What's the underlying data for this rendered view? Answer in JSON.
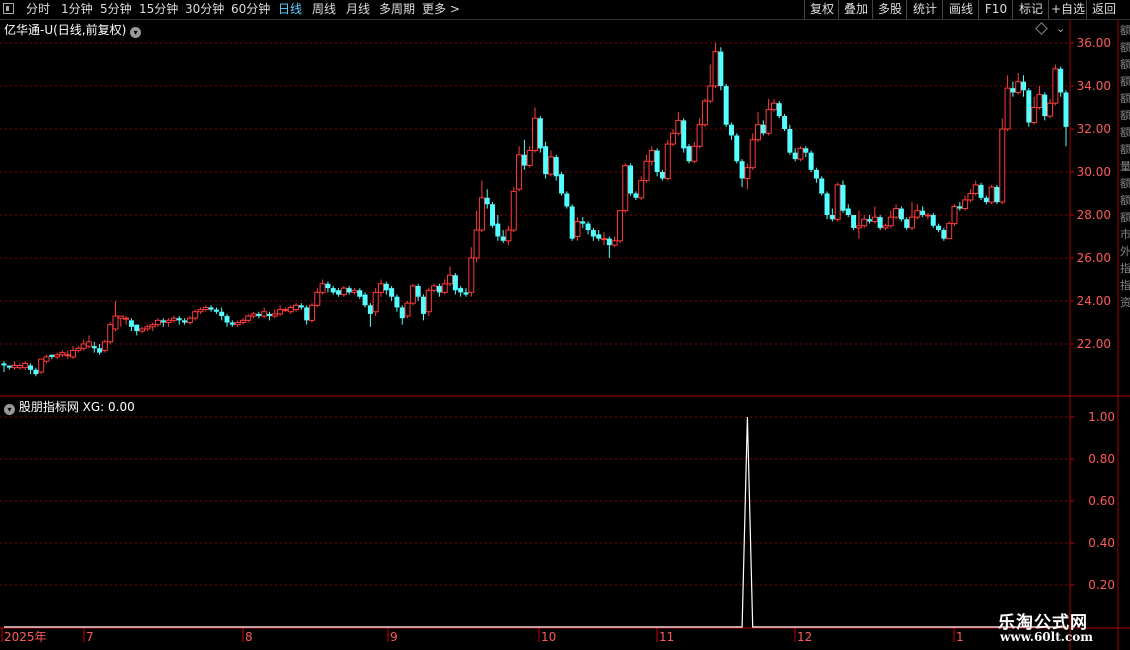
{
  "toolbar": {
    "periods": [
      "分时",
      "1分钟",
      "5分钟",
      "15分钟",
      "30分钟",
      "60分钟",
      "日线",
      "周线",
      "月线",
      "多周期",
      "更多 >"
    ],
    "active_period": "日线",
    "buttons": [
      "复权",
      "叠加",
      "多股",
      "统计",
      "画线",
      "F10",
      "标记",
      "+自选",
      "返回"
    ]
  },
  "main_chart": {
    "title": "亿华通-U(日线,前复权)",
    "price_axis": [
      "36.00",
      "34.00",
      "32.00",
      "30.00",
      "28.00",
      "26.00",
      "24.00",
      "22.00"
    ],
    "candles": [
      [
        21.1,
        21.0,
        20.8,
        20.7,
        21.2
      ],
      [
        21.0,
        20.9,
        20.8,
        20.8,
        21.0
      ],
      [
        20.9,
        21.0,
        20.8,
        20.8,
        21.2
      ],
      [
        20.9,
        21.0,
        20.9,
        20.8,
        21.1
      ],
      [
        20.9,
        21.1,
        20.9,
        20.8,
        21.2
      ],
      [
        21.0,
        20.8,
        20.7,
        20.6,
        21.1
      ],
      [
        20.8,
        20.6,
        20.6,
        20.5,
        20.9
      ],
      [
        20.7,
        21.3,
        20.7,
        20.6,
        21.3
      ],
      [
        21.2,
        21.4,
        21.2,
        21.1,
        21.5
      ],
      [
        21.5,
        21.4,
        21.3,
        21.3,
        21.5
      ],
      [
        21.4,
        21.5,
        21.3,
        21.3,
        21.6
      ],
      [
        21.5,
        21.6,
        21.5,
        21.4,
        21.7
      ],
      [
        21.5,
        21.5,
        21.3,
        21.3,
        21.7
      ],
      [
        21.4,
        21.7,
        21.4,
        21.3,
        21.9
      ],
      [
        21.7,
        21.8,
        21.6,
        21.6,
        21.9
      ],
      [
        21.8,
        22.0,
        21.7,
        21.7,
        22.2
      ],
      [
        21.9,
        22.1,
        21.9,
        21.8,
        22.4
      ],
      [
        21.9,
        21.8,
        21.6,
        21.6,
        22.1
      ],
      [
        21.8,
        21.6,
        21.6,
        21.5,
        22.0
      ],
      [
        21.7,
        22.1,
        21.7,
        21.6,
        22.2
      ],
      [
        22.1,
        22.9,
        22.1,
        22.0,
        23.0
      ],
      [
        22.7,
        23.3,
        22.7,
        22.6,
        24.0
      ],
      [
        23.2,
        23.3,
        23.1,
        22.8,
        23.3
      ],
      [
        23.2,
        23.2,
        23.0,
        22.9,
        23.3
      ],
      [
        23.1,
        22.8,
        22.8,
        22.6,
        23.2
      ],
      [
        22.9,
        22.6,
        22.5,
        22.4,
        22.9
      ],
      [
        22.6,
        22.7,
        22.6,
        22.5,
        22.8
      ],
      [
        22.7,
        22.8,
        22.7,
        22.6,
        22.9
      ],
      [
        22.8,
        22.9,
        22.7,
        22.6,
        23.0
      ],
      [
        22.9,
        23.1,
        22.8,
        22.8,
        23.2
      ],
      [
        23.1,
        23.0,
        22.9,
        22.8,
        23.2
      ],
      [
        23.0,
        23.1,
        22.9,
        22.8,
        23.2
      ],
      [
        23.1,
        23.2,
        23.0,
        23.0,
        23.3
      ],
      [
        23.2,
        23.1,
        23.0,
        22.9,
        23.3
      ],
      [
        23.1,
        23.0,
        22.9,
        22.9,
        23.2
      ],
      [
        23.0,
        23.2,
        23.0,
        22.9,
        23.3
      ],
      [
        23.2,
        23.5,
        23.2,
        23.1,
        23.6
      ],
      [
        23.5,
        23.6,
        23.4,
        23.4,
        23.7
      ],
      [
        23.6,
        23.7,
        23.5,
        23.5,
        23.8
      ],
      [
        23.7,
        23.6,
        23.5,
        23.5,
        23.8
      ],
      [
        23.6,
        23.5,
        23.4,
        23.4,
        23.7
      ],
      [
        23.5,
        23.3,
        23.2,
        23.1,
        23.7
      ],
      [
        23.3,
        23.0,
        22.9,
        22.8,
        23.4
      ],
      [
        23.0,
        22.9,
        22.9,
        22.8,
        23.1
      ],
      [
        22.9,
        23.0,
        22.9,
        22.8,
        23.1
      ],
      [
        23.0,
        23.1,
        22.9,
        22.9,
        23.2
      ],
      [
        23.1,
        23.3,
        23.1,
        23.0,
        23.4
      ],
      [
        23.3,
        23.4,
        23.2,
        23.2,
        23.5
      ],
      [
        23.4,
        23.3,
        23.2,
        23.2,
        23.5
      ],
      [
        23.3,
        23.5,
        23.3,
        23.2,
        23.7
      ],
      [
        23.4,
        23.3,
        23.2,
        23.1,
        23.5
      ],
      [
        23.3,
        23.4,
        23.2,
        23.2,
        23.6
      ],
      [
        23.4,
        23.6,
        23.4,
        23.3,
        23.8
      ],
      [
        23.6,
        23.6,
        23.5,
        23.5,
        23.7
      ],
      [
        23.5,
        23.7,
        23.5,
        23.4,
        23.8
      ],
      [
        23.6,
        23.8,
        23.6,
        23.5,
        23.9
      ],
      [
        23.8,
        23.7,
        23.6,
        23.6,
        23.9
      ],
      [
        23.7,
        23.1,
        23.0,
        22.9,
        23.8
      ],
      [
        23.1,
        23.8,
        23.1,
        23.0,
        23.9
      ],
      [
        23.8,
        24.4,
        23.7,
        23.7,
        24.6
      ],
      [
        24.4,
        24.8,
        24.4,
        24.3,
        25.0
      ],
      [
        24.8,
        24.6,
        24.5,
        24.4,
        24.9
      ],
      [
        24.6,
        24.4,
        24.3,
        24.3,
        24.7
      ],
      [
        24.5,
        24.3,
        24.2,
        24.2,
        24.6
      ],
      [
        24.3,
        24.6,
        24.3,
        24.2,
        24.7
      ],
      [
        24.6,
        24.4,
        24.3,
        24.3,
        24.7
      ],
      [
        24.4,
        24.5,
        24.4,
        24.3,
        24.6
      ],
      [
        24.5,
        24.2,
        24.1,
        24.1,
        24.6
      ],
      [
        24.3,
        23.8,
        23.8,
        23.7,
        24.4
      ],
      [
        23.8,
        23.4,
        23.3,
        22.8,
        23.9
      ],
      [
        23.5,
        24.4,
        23.5,
        23.3,
        24.6
      ],
      [
        24.4,
        24.8,
        24.3,
        24.2,
        25.0
      ],
      [
        24.8,
        24.5,
        24.4,
        24.3,
        24.9
      ],
      [
        24.6,
        24.2,
        24.1,
        24.0,
        24.7
      ],
      [
        24.2,
        23.7,
        23.6,
        23.5,
        24.3
      ],
      [
        23.7,
        23.2,
        23.2,
        22.9,
        23.8
      ],
      [
        23.3,
        23.9,
        23.3,
        23.2,
        24.0
      ],
      [
        23.9,
        24.7,
        23.8,
        23.8,
        24.8
      ],
      [
        24.7,
        24.2,
        24.1,
        24.0,
        24.8
      ],
      [
        24.2,
        23.4,
        23.4,
        23.1,
        24.3
      ],
      [
        23.5,
        24.5,
        23.4,
        23.3,
        24.6
      ],
      [
        24.5,
        24.7,
        24.4,
        24.4,
        24.8
      ],
      [
        24.7,
        24.4,
        24.3,
        24.2,
        24.8
      ],
      [
        24.4,
        24.8,
        24.3,
        24.3,
        25.0
      ],
      [
        24.8,
        25.2,
        24.7,
        24.7,
        25.6
      ],
      [
        25.2,
        24.5,
        24.4,
        24.3,
        25.3
      ],
      [
        24.6,
        24.4,
        24.3,
        24.2,
        24.7
      ],
      [
        24.4,
        24.3,
        24.2,
        24.2,
        24.6
      ],
      [
        24.4,
        26.0,
        24.4,
        24.2,
        26.5
      ],
      [
        26.0,
        27.3,
        26.0,
        25.8,
        28.2
      ],
      [
        27.3,
        28.8,
        27.3,
        27.2,
        29.6
      ],
      [
        28.8,
        28.5,
        28.4,
        28.3,
        29.2
      ],
      [
        28.5,
        27.5,
        27.4,
        27.4,
        28.6
      ],
      [
        27.6,
        27.0,
        26.9,
        26.8,
        28.0
      ],
      [
        27.0,
        26.8,
        26.7,
        26.7,
        27.3
      ],
      [
        26.8,
        27.3,
        26.8,
        26.6,
        27.5
      ],
      [
        27.3,
        29.1,
        27.2,
        27.2,
        29.3
      ],
      [
        29.2,
        30.8,
        29.1,
        29.1,
        31.2
      ],
      [
        30.8,
        30.3,
        30.2,
        30.1,
        31.5
      ],
      [
        30.3,
        31.0,
        30.2,
        30.2,
        31.2
      ],
      [
        31.0,
        32.5,
        31.0,
        30.9,
        33.0
      ],
      [
        32.5,
        31.1,
        31.0,
        30.9,
        32.6
      ],
      [
        31.2,
        29.9,
        29.8,
        29.7,
        31.4
      ],
      [
        29.9,
        30.7,
        29.8,
        29.8,
        31.0
      ],
      [
        30.7,
        29.8,
        29.7,
        29.6,
        30.8
      ],
      [
        29.9,
        29.0,
        29.0,
        28.9,
        30.0
      ],
      [
        29.0,
        28.4,
        28.3,
        28.3,
        29.1
      ],
      [
        28.4,
        26.9,
        26.9,
        26.8,
        28.5
      ],
      [
        27.0,
        27.7,
        26.9,
        26.8,
        27.9
      ],
      [
        27.7,
        27.6,
        27.4,
        27.4,
        27.9
      ],
      [
        27.6,
        27.3,
        27.2,
        27.1,
        27.7
      ],
      [
        27.3,
        27.0,
        26.9,
        26.8,
        27.4
      ],
      [
        27.1,
        26.9,
        26.8,
        26.8,
        27.3
      ],
      [
        26.9,
        26.9,
        26.7,
        26.6,
        27.2
      ],
      [
        26.9,
        26.6,
        26.6,
        26.0,
        27.0
      ],
      [
        26.6,
        26.8,
        26.6,
        26.5,
        27.0
      ],
      [
        26.8,
        28.2,
        26.8,
        26.7,
        28.2
      ],
      [
        28.2,
        30.3,
        28.1,
        28.1,
        30.4
      ],
      [
        30.3,
        29.0,
        29.0,
        28.9,
        30.4
      ],
      [
        29.0,
        28.8,
        28.7,
        28.7,
        29.1
      ],
      [
        28.8,
        29.6,
        28.8,
        28.7,
        29.8
      ],
      [
        29.6,
        30.5,
        29.5,
        29.5,
        30.8
      ],
      [
        30.5,
        31.0,
        30.4,
        30.3,
        31.2
      ],
      [
        31.0,
        30.0,
        29.9,
        29.8,
        31.1
      ],
      [
        30.0,
        29.7,
        29.6,
        29.6,
        30.1
      ],
      [
        29.7,
        31.3,
        29.6,
        29.6,
        31.5
      ],
      [
        31.3,
        31.8,
        31.2,
        31.2,
        32.0
      ],
      [
        31.8,
        32.4,
        31.7,
        31.7,
        32.8
      ],
      [
        32.4,
        31.1,
        31.0,
        30.9,
        32.5
      ],
      [
        31.2,
        30.5,
        30.4,
        30.4,
        31.3
      ],
      [
        30.5,
        31.2,
        30.5,
        30.4,
        31.4
      ],
      [
        31.2,
        32.2,
        31.2,
        31.1,
        32.5
      ],
      [
        32.2,
        33.3,
        32.2,
        32.1,
        33.4
      ],
      [
        33.3,
        34.0,
        33.3,
        33.2,
        35.0
      ],
      [
        34.0,
        35.6,
        34.0,
        33.9,
        36.0
      ],
      [
        35.6,
        34.0,
        33.9,
        33.8,
        35.8
      ],
      [
        34.0,
        32.2,
        32.1,
        32.1,
        34.1
      ],
      [
        32.2,
        31.7,
        31.6,
        31.5,
        32.3
      ],
      [
        31.7,
        30.5,
        30.5,
        30.4,
        31.8
      ],
      [
        30.5,
        29.7,
        29.6,
        29.3,
        30.6
      ],
      [
        29.7,
        30.2,
        29.7,
        29.2,
        30.4
      ],
      [
        30.2,
        31.5,
        30.2,
        30.1,
        31.8
      ],
      [
        31.5,
        32.2,
        31.5,
        31.4,
        32.8
      ],
      [
        32.2,
        31.8,
        31.7,
        31.7,
        32.4
      ],
      [
        31.8,
        32.9,
        31.8,
        31.7,
        33.4
      ],
      [
        32.9,
        33.2,
        32.8,
        32.8,
        33.4
      ],
      [
        33.2,
        32.6,
        32.5,
        32.5,
        33.3
      ],
      [
        32.6,
        32.0,
        31.9,
        31.9,
        32.7
      ],
      [
        32.0,
        30.9,
        30.9,
        30.8,
        32.2
      ],
      [
        30.9,
        30.6,
        30.5,
        30.5,
        31.1
      ],
      [
        30.6,
        31.1,
        30.6,
        30.5,
        31.2
      ],
      [
        31.1,
        30.9,
        30.8,
        30.7,
        31.2
      ],
      [
        30.9,
        30.1,
        30.0,
        30.0,
        31.0
      ],
      [
        30.1,
        29.7,
        29.6,
        29.5,
        30.2
      ],
      [
        29.7,
        29.0,
        29.0,
        28.9,
        29.8
      ],
      [
        29.0,
        28.0,
        27.9,
        27.8,
        29.1
      ],
      [
        28.0,
        27.8,
        27.7,
        27.7,
        28.3
      ],
      [
        27.8,
        29.4,
        27.8,
        27.7,
        29.5
      ],
      [
        29.4,
        28.2,
        28.1,
        28.1,
        29.6
      ],
      [
        28.3,
        28.0,
        27.9,
        27.9,
        28.5
      ],
      [
        28.0,
        27.4,
        27.3,
        27.3,
        28.0
      ],
      [
        27.4,
        27.5,
        27.3,
        26.9,
        28.2
      ],
      [
        27.5,
        27.8,
        27.4,
        27.4,
        28.0
      ],
      [
        27.8,
        27.7,
        27.6,
        27.6,
        28.0
      ],
      [
        27.7,
        27.9,
        27.6,
        27.6,
        28.4
      ],
      [
        27.9,
        27.4,
        27.3,
        27.3,
        28.0
      ],
      [
        27.4,
        27.5,
        27.3,
        27.3,
        27.6
      ],
      [
        27.5,
        27.9,
        27.5,
        27.4,
        28.2
      ],
      [
        27.9,
        28.3,
        27.9,
        27.8,
        28.5
      ],
      [
        28.3,
        27.8,
        27.7,
        27.7,
        28.4
      ],
      [
        27.8,
        27.4,
        27.3,
        27.3,
        27.9
      ],
      [
        27.4,
        27.9,
        27.4,
        27.3,
        28.6
      ],
      [
        27.9,
        28.2,
        27.9,
        27.8,
        28.5
      ],
      [
        28.2,
        28.0,
        27.9,
        27.9,
        28.4
      ],
      [
        28.0,
        28.0,
        27.8,
        27.8,
        28.1
      ],
      [
        28.0,
        27.5,
        27.4,
        27.4,
        28.1
      ],
      [
        27.5,
        27.3,
        27.2,
        27.2,
        27.6
      ],
      [
        27.3,
        26.9,
        26.9,
        26.8,
        27.4
      ],
      [
        26.9,
        27.6,
        26.9,
        26.9,
        27.7
      ],
      [
        27.6,
        28.4,
        27.6,
        27.5,
        28.5
      ],
      [
        28.4,
        28.3,
        28.2,
        28.2,
        28.6
      ],
      [
        28.3,
        28.7,
        28.3,
        28.2,
        28.9
      ],
      [
        28.7,
        29.0,
        28.7,
        28.6,
        29.2
      ],
      [
        29.0,
        29.4,
        29.0,
        28.9,
        29.6
      ],
      [
        29.4,
        28.8,
        28.8,
        28.7,
        29.5
      ],
      [
        28.8,
        28.6,
        28.5,
        28.5,
        28.9
      ],
      [
        28.6,
        29.3,
        28.6,
        28.5,
        29.4
      ],
      [
        29.3,
        28.6,
        28.5,
        28.5,
        29.4
      ],
      [
        28.6,
        32.0,
        28.6,
        28.5,
        32.5
      ],
      [
        32.0,
        33.9,
        32.0,
        31.9,
        34.5
      ],
      [
        33.9,
        33.7,
        33.6,
        33.5,
        34.2
      ],
      [
        33.7,
        34.2,
        33.6,
        33.6,
        34.6
      ],
      [
        34.2,
        33.8,
        33.7,
        33.5,
        34.5
      ],
      [
        33.8,
        32.3,
        32.2,
        32.1,
        33.9
      ],
      [
        32.3,
        33.0,
        32.3,
        32.2,
        33.5
      ],
      [
        33.0,
        33.6,
        33.0,
        32.9,
        34.0
      ],
      [
        33.6,
        32.6,
        32.5,
        32.4,
        33.7
      ],
      [
        32.6,
        33.2,
        32.5,
        32.5,
        33.4
      ],
      [
        33.2,
        34.8,
        33.2,
        33.1,
        35.0
      ],
      [
        34.8,
        33.7,
        33.6,
        33.5,
        34.9
      ],
      [
        33.7,
        32.1,
        32.1,
        31.2,
        33.8
      ]
    ],
    "dates": [
      "2025年",
      "7",
      "8",
      "9",
      "10",
      "11",
      "12",
      "1"
    ]
  },
  "indicator": {
    "title": "股朋指标网 XG: 0.00",
    "axis": [
      "1.00",
      "0.80",
      "0.60",
      "0.40",
      "0.20"
    ],
    "signals": [
      140,
      201
    ]
  },
  "right_strip_chars": [
    "额",
    "额",
    "额",
    "额",
    "额",
    "额",
    "额",
    "额",
    "量",
    "额",
    "额",
    "额",
    "市",
    "外",
    "指",
    "指",
    "资"
  ],
  "logo": {
    "name": "乐淘公式网",
    "url": "www.60lt.com"
  },
  "colors": {
    "up": "#ff3b3b",
    "down": "#54ffff",
    "grid": "#8b0000",
    "axis_text": "#ff5a5a"
  }
}
